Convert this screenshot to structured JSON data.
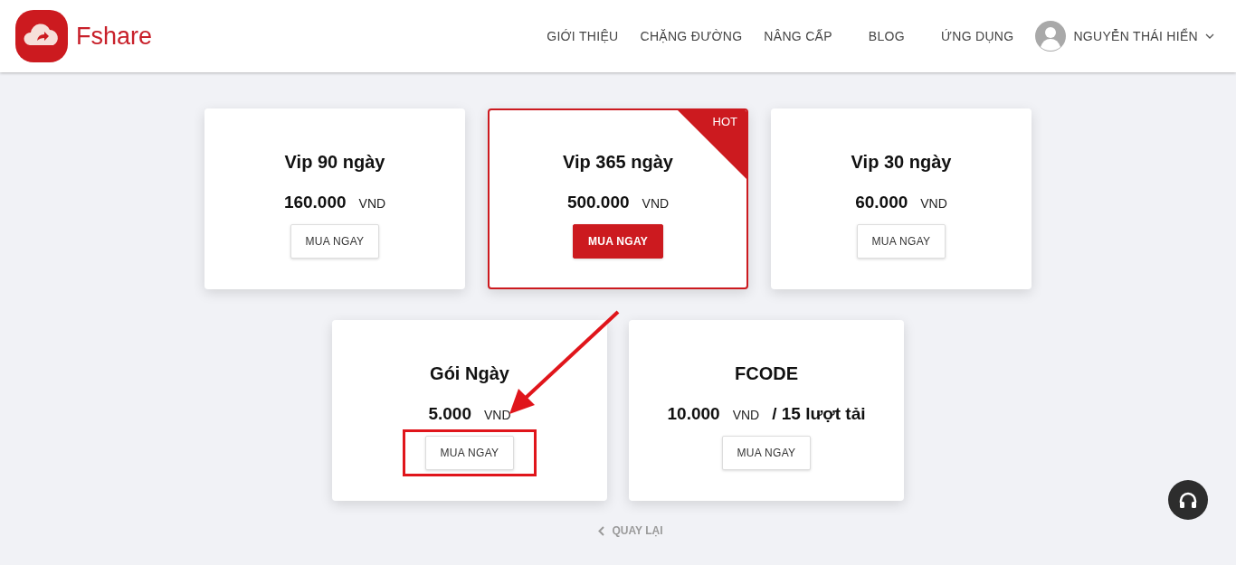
{
  "brand": {
    "name": "Fshare"
  },
  "nav": {
    "items": [
      {
        "label": "GIỚI THIỆU"
      },
      {
        "label": "CHẶNG ĐƯỜNG"
      },
      {
        "label": "NÂNG CẤP"
      },
      {
        "label": "BLOG"
      },
      {
        "label": "ỨNG DỤNG"
      }
    ],
    "user": {
      "name": "NGUYỄN THÁI HIỂN"
    }
  },
  "plan_rows": [
    [
      {
        "title": "Vip 90 ngày",
        "price": "160.000",
        "currency": "VND",
        "button": "MUA NGAY",
        "featured": false,
        "highlighted": false
      },
      {
        "title": "Vip 365 ngày",
        "price": "500.000",
        "currency": "VND",
        "button": "MUA NGAY",
        "featured": true,
        "badge": "HOT",
        "highlighted": false
      },
      {
        "title": "Vip 30 ngày",
        "price": "60.000",
        "currency": "VND",
        "button": "MUA NGAY",
        "featured": false,
        "highlighted": false
      }
    ],
    [
      {
        "title": "Gói Ngày",
        "price": "5.000",
        "currency": "VND",
        "button": "MUA NGAY",
        "featured": false,
        "highlighted": true
      },
      {
        "title": "FCODE",
        "price": "10.000",
        "currency": "VND",
        "suffix": "/ 15 lượt tải",
        "button": "MUA NGAY",
        "featured": false,
        "highlighted": false
      }
    ]
  ],
  "back_link": {
    "label": "QUAY LẠI"
  }
}
